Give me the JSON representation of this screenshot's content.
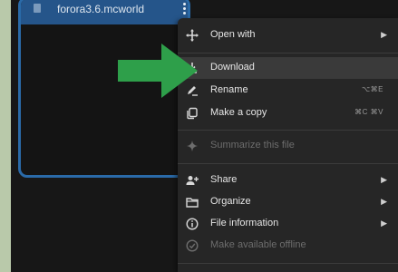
{
  "file": {
    "name": "forora3.6.mcworld"
  },
  "menu": {
    "items": [
      {
        "label": "Open with",
        "icon": "open-with-icon",
        "submenu": true
      },
      {
        "label": "Download",
        "icon": "download-icon",
        "highlighted": true
      },
      {
        "label": "Rename",
        "icon": "rename-icon",
        "shortcut": "⌥⌘E"
      },
      {
        "label": "Make a copy",
        "icon": "copy-icon",
        "shortcut": "⌘C ⌘V"
      },
      {
        "label": "Summarize this file",
        "icon": "sparkle-icon",
        "disabled": true
      },
      {
        "label": "Share",
        "icon": "share-icon",
        "submenu": true
      },
      {
        "label": "Organize",
        "icon": "folder-icon",
        "submenu": true
      },
      {
        "label": "File information",
        "icon": "info-icon",
        "submenu": true
      },
      {
        "label": "Make available offline",
        "icon": "offline-icon",
        "disabled": true
      }
    ]
  },
  "colors": {
    "accent_arrow": "#2e9f4a",
    "card_border": "#2a6aa8",
    "menu_bg": "#262626"
  }
}
